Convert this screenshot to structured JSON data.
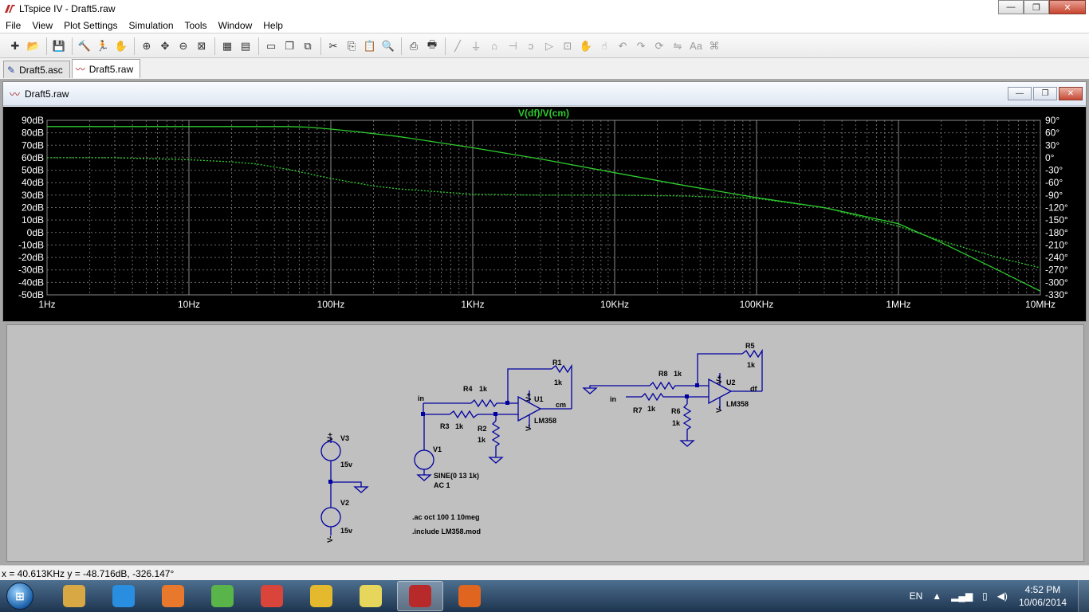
{
  "window": {
    "title": "LTspice IV - Draft5.raw",
    "controls": {
      "minimize": "—",
      "maximize": "❐",
      "close": "✕"
    }
  },
  "menu": [
    "File",
    "View",
    "Plot Settings",
    "Simulation",
    "Tools",
    "Window",
    "Help"
  ],
  "toolbar": [
    "new-schematic-icon",
    "open-icon",
    "save-icon",
    "control-panel-icon",
    "run-icon",
    "halt-icon",
    "zoom-in-icon",
    "pan-icon",
    "zoom-out-icon",
    "zoom-fit-icon",
    "autorange-icon",
    "add-trace-icon",
    "tile-horizontal-icon",
    "cascade-icon",
    "close-window-icon",
    "cut-icon",
    "copy-icon",
    "paste-icon",
    "find-icon",
    "print-setup-icon",
    "print-icon",
    "draw-wire-icon",
    "ground-icon",
    "label-net-icon",
    "capacitor-icon",
    "inductor-icon",
    "diode-icon",
    "component-icon",
    "move-icon",
    "drag-icon",
    "undo-icon",
    "redo-icon",
    "rotate-icon",
    "mirror-icon",
    "text-icon",
    "spice-directive-icon"
  ],
  "tabs": [
    {
      "label": "Draft5.asc",
      "icon": "schematic-icon",
      "active": false
    },
    {
      "label": "Draft5.raw",
      "icon": "waveform-icon",
      "active": true
    }
  ],
  "plot_window": {
    "title": "Draft5.raw",
    "controls": {
      "minimize": "—",
      "maximize": "❐",
      "close": "✕"
    }
  },
  "chart_data": {
    "type": "line",
    "title": "V(df)/V(cm)",
    "x_scale": "log",
    "xlim": [
      1,
      10000000
    ],
    "x_tick_labels": [
      "1Hz",
      "10Hz",
      "100Hz",
      "1KHz",
      "10KHz",
      "100KHz",
      "1MHz",
      "10MHz"
    ],
    "y_left_tick_labels": [
      "90dB",
      "80dB",
      "70dB",
      "60dB",
      "50dB",
      "40dB",
      "30dB",
      "20dB",
      "10dB",
      "0dB",
      "-10dB",
      "-20dB",
      "-30dB",
      "-40dB",
      "-50dB"
    ],
    "y_right_tick_labels": [
      "90°",
      "60°",
      "30°",
      "0°",
      "-30°",
      "-60°",
      "-90°",
      "-120°",
      "-150°",
      "-180°",
      "-210°",
      "-240°",
      "-270°",
      "-300°",
      "-330°"
    ],
    "ylim_db": [
      -50,
      90
    ],
    "ylim_deg": [
      -330,
      90
    ],
    "grid": true,
    "background": "#000000",
    "trace_color": "#2ecc2e",
    "series": [
      {
        "name": "magnitude",
        "unit": "dB",
        "style": "solid",
        "x": [
          1,
          10,
          50,
          70,
          100,
          150,
          300,
          1000,
          3000,
          10000,
          30000,
          100000,
          300000,
          1000000,
          2000000,
          5000000,
          10000000
        ],
        "y": [
          85,
          85,
          85,
          84.5,
          83,
          81,
          77,
          68,
          59,
          48,
          38,
          28,
          20,
          7,
          -8,
          -30,
          -47
        ]
      },
      {
        "name": "phase",
        "unit": "deg",
        "style": "dashed",
        "x": [
          1,
          3,
          10,
          20,
          30,
          50,
          100,
          200,
          300,
          1000,
          3000,
          10000,
          30000,
          100000,
          300000,
          1000000,
          2000000,
          5000000,
          10000000
        ],
        "y": [
          0,
          0,
          -5,
          -10,
          -15,
          -28,
          -50,
          -68,
          -75,
          -88,
          -90,
          -90,
          -92,
          -98,
          -120,
          -165,
          -200,
          -240,
          -265
        ]
      }
    ]
  },
  "schematic": {
    "labels": {
      "in_left": "in",
      "R4": "R4",
      "R4v": "1k",
      "R3": "R3",
      "R3v": "1k",
      "R2": "R2",
      "R2v": "1k",
      "R1": "R1",
      "R1v": "1k",
      "U1": "U1",
      "U1m": "LM358",
      "cm": "cm",
      "vplus1": "V+",
      "vminus1": "V-",
      "V1": "V1",
      "V1a": "SINE(0 13 1k)",
      "V1b": "AC 1",
      "V3": "V3",
      "V3v": "15v",
      "V2": "V2",
      "V2v": "15v",
      "vplus3": "V+",
      "vminus2": "V-",
      "R8": "R8",
      "R8v": "1k",
      "R7": "R7",
      "R7v": "1k",
      "R6": "R6",
      "R6v": "1k",
      "R5": "R5",
      "R5v": "1k",
      "U2": "U2",
      "U2m": "LM358",
      "df": "df",
      "in_right": "in",
      "vplus2": "V+",
      "vminus3": "V-",
      "dir1": ".ac oct 100 1 10meg",
      "dir2": ".include LM358.mod"
    }
  },
  "status": {
    "text": "x = 40.613KHz   y = -48.716dB, -326.147°"
  },
  "taskbar": {
    "apps": [
      {
        "name": "explorer",
        "color": "#d7a843"
      },
      {
        "name": "internet-explorer",
        "color": "#2a8ee0"
      },
      {
        "name": "media-player",
        "color": "#e7782c"
      },
      {
        "name": "messenger",
        "color": "#59b44a"
      },
      {
        "name": "photo-tool",
        "color": "#d9453a"
      },
      {
        "name": "chrome",
        "color": "#e5b92d"
      },
      {
        "name": "sticky-notes",
        "color": "#e6d65c"
      },
      {
        "name": "ltspice",
        "color": "#b82a2a"
      },
      {
        "name": "firefox",
        "color": "#e0651f"
      }
    ],
    "language": "EN",
    "time": "4:52 PM",
    "date": "10/06/2014"
  }
}
